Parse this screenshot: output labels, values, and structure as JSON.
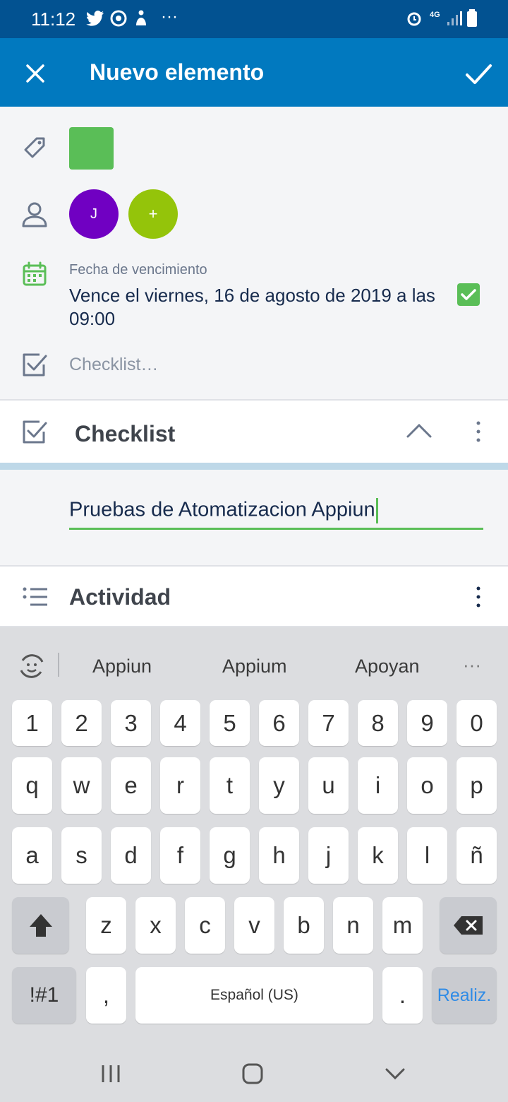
{
  "status_bar": {
    "time": "11:12",
    "network": "4G",
    "more": "···"
  },
  "app_bar": {
    "title": "Nuevo elemento"
  },
  "card": {
    "due_label": "Fecha de vencimiento",
    "due_value": "Vence el viernes, 16 de agosto de 2019 a las 09:00",
    "checklist_placeholder": "Checklist…",
    "members": [
      {
        "initial": "J",
        "color": "#7000c2"
      }
    ],
    "add_member": "+",
    "label_color": "#5abe57"
  },
  "checklist": {
    "title": "Checklist",
    "item_value": "Pruebas de Atomatizacion Appiun"
  },
  "activity": {
    "title": "Actividad"
  },
  "keyboard": {
    "suggestions": [
      "Appiun",
      "Appium",
      "Apoyan"
    ],
    "row_numbers": [
      "1",
      "2",
      "3",
      "4",
      "5",
      "6",
      "7",
      "8",
      "9",
      "0"
    ],
    "row_1": [
      "q",
      "w",
      "e",
      "r",
      "t",
      "y",
      "u",
      "i",
      "o",
      "p"
    ],
    "row_2": [
      "a",
      "s",
      "d",
      "f",
      "g",
      "h",
      "j",
      "k",
      "l",
      "ñ"
    ],
    "row_3": [
      "z",
      "x",
      "c",
      "v",
      "b",
      "n",
      "m"
    ],
    "symbols_key": "!#1",
    "comma_key": ",",
    "space_key": "Español (US)",
    "period_key": ".",
    "done_key": "Realiz."
  },
  "colors": {
    "status_bar": "#025291",
    "app_bar": "#0179bf",
    "accent_green": "#5abe57",
    "done_blue": "#2f8be6"
  }
}
